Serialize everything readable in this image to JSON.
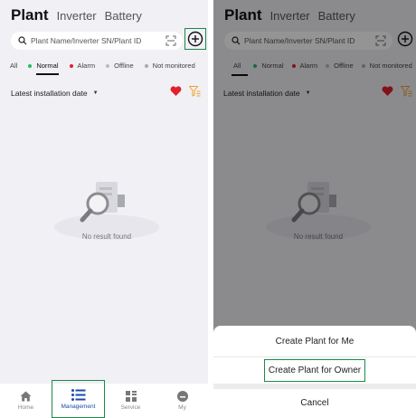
{
  "tabs": {
    "plant": "Plant",
    "inverter": "Inverter",
    "battery": "Battery"
  },
  "search": {
    "placeholder": "Plant Name/Inverter SN/Plant ID"
  },
  "filters": [
    {
      "label": "All",
      "dot": ""
    },
    {
      "label": "Normal",
      "dot": "#22bb66"
    },
    {
      "label": "Alarm",
      "dot": "#e0202a"
    },
    {
      "label": "Offline",
      "dot": "#bbbbbb"
    },
    {
      "label": "Not monitored",
      "dot": "#aaaaaa"
    }
  ],
  "sort": {
    "label": "Latest installation date"
  },
  "empty": {
    "text": "No result found"
  },
  "nav": {
    "home": "Home",
    "management": "Management",
    "service": "Service",
    "my": "My"
  },
  "sheet": {
    "create_for_me": "Create Plant for Me",
    "create_for_owner": "Create Plant for Owner",
    "cancel": "Cancel"
  },
  "icons": {
    "search": "search-icon",
    "scan": "scan-icon",
    "add": "add-circle-icon",
    "heart": "heart-icon",
    "filter": "filter-icon",
    "home": "home-icon",
    "management": "list-icon",
    "service": "grid-icon",
    "my": "profile-icon"
  },
  "colors": {
    "accent": "#1a4aa8",
    "highlight": "#1a8a4a",
    "heart": "#e0202a",
    "filter": "#f0a030"
  }
}
